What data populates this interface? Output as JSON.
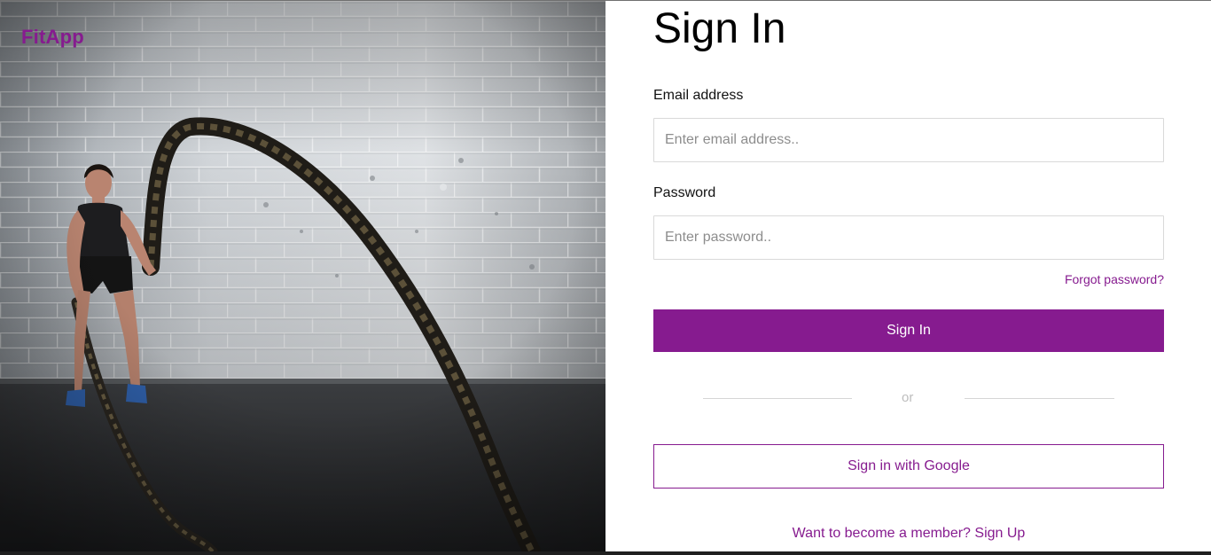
{
  "brand": {
    "logo_text": "FitApp",
    "accent_color": "#861b8f"
  },
  "hero": {
    "image_subject": "woman training with battle ropes"
  },
  "form": {
    "title": "Sign In",
    "email": {
      "label": "Email address",
      "placeholder": "Enter email address..",
      "value": ""
    },
    "password": {
      "label": "Password",
      "placeholder": "Enter password..",
      "value": ""
    },
    "forgot_link": "Forgot password?",
    "submit_label": "Sign In",
    "divider_text": "or",
    "google_label": "Sign in with Google",
    "signup_prompt": "Want to become a member?",
    "signup_link": "Sign Up"
  }
}
